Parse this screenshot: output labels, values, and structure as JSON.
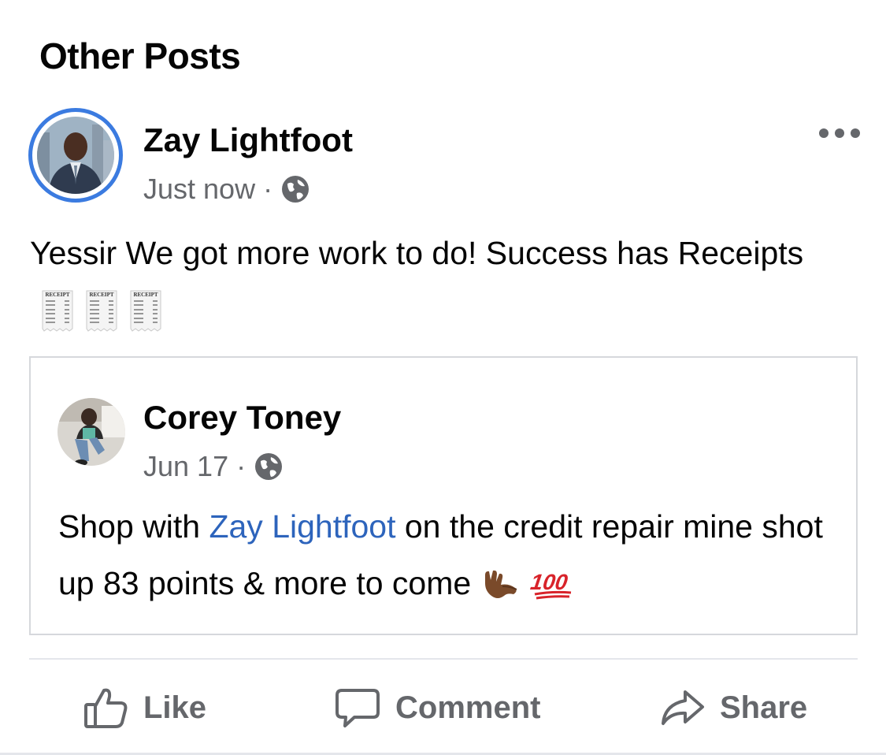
{
  "section": {
    "title": "Other Posts"
  },
  "post": {
    "author": "Zay Lightfoot",
    "time": "Just now",
    "separator": "·",
    "privacy_icon": "globe-icon",
    "more_icon": "more-dots-icon",
    "text": "Yessir We got more work to do! Success has Receipts",
    "emoji": "receipt-emoji",
    "receipt_label": "RECEIPT"
  },
  "shared_post": {
    "author": "Corey Toney",
    "time": "Jun 17",
    "separator": "·",
    "privacy_icon": "globe-icon",
    "text_before": "Shop with ",
    "mention": "Zay Lightfoot",
    "text_after": " on the credit repair mine shot up 83 points & more to come",
    "emojis": [
      "call-me-hand-emoji",
      "hundred-points-emoji"
    ],
    "hundred_label": "100"
  },
  "actions": {
    "like": "Like",
    "comment": "Comment",
    "share": "Share"
  },
  "colors": {
    "accent": "#3b7be0",
    "mention": "#2d64bc",
    "secondary_text": "#65676b",
    "border": "#d6d8dc"
  }
}
